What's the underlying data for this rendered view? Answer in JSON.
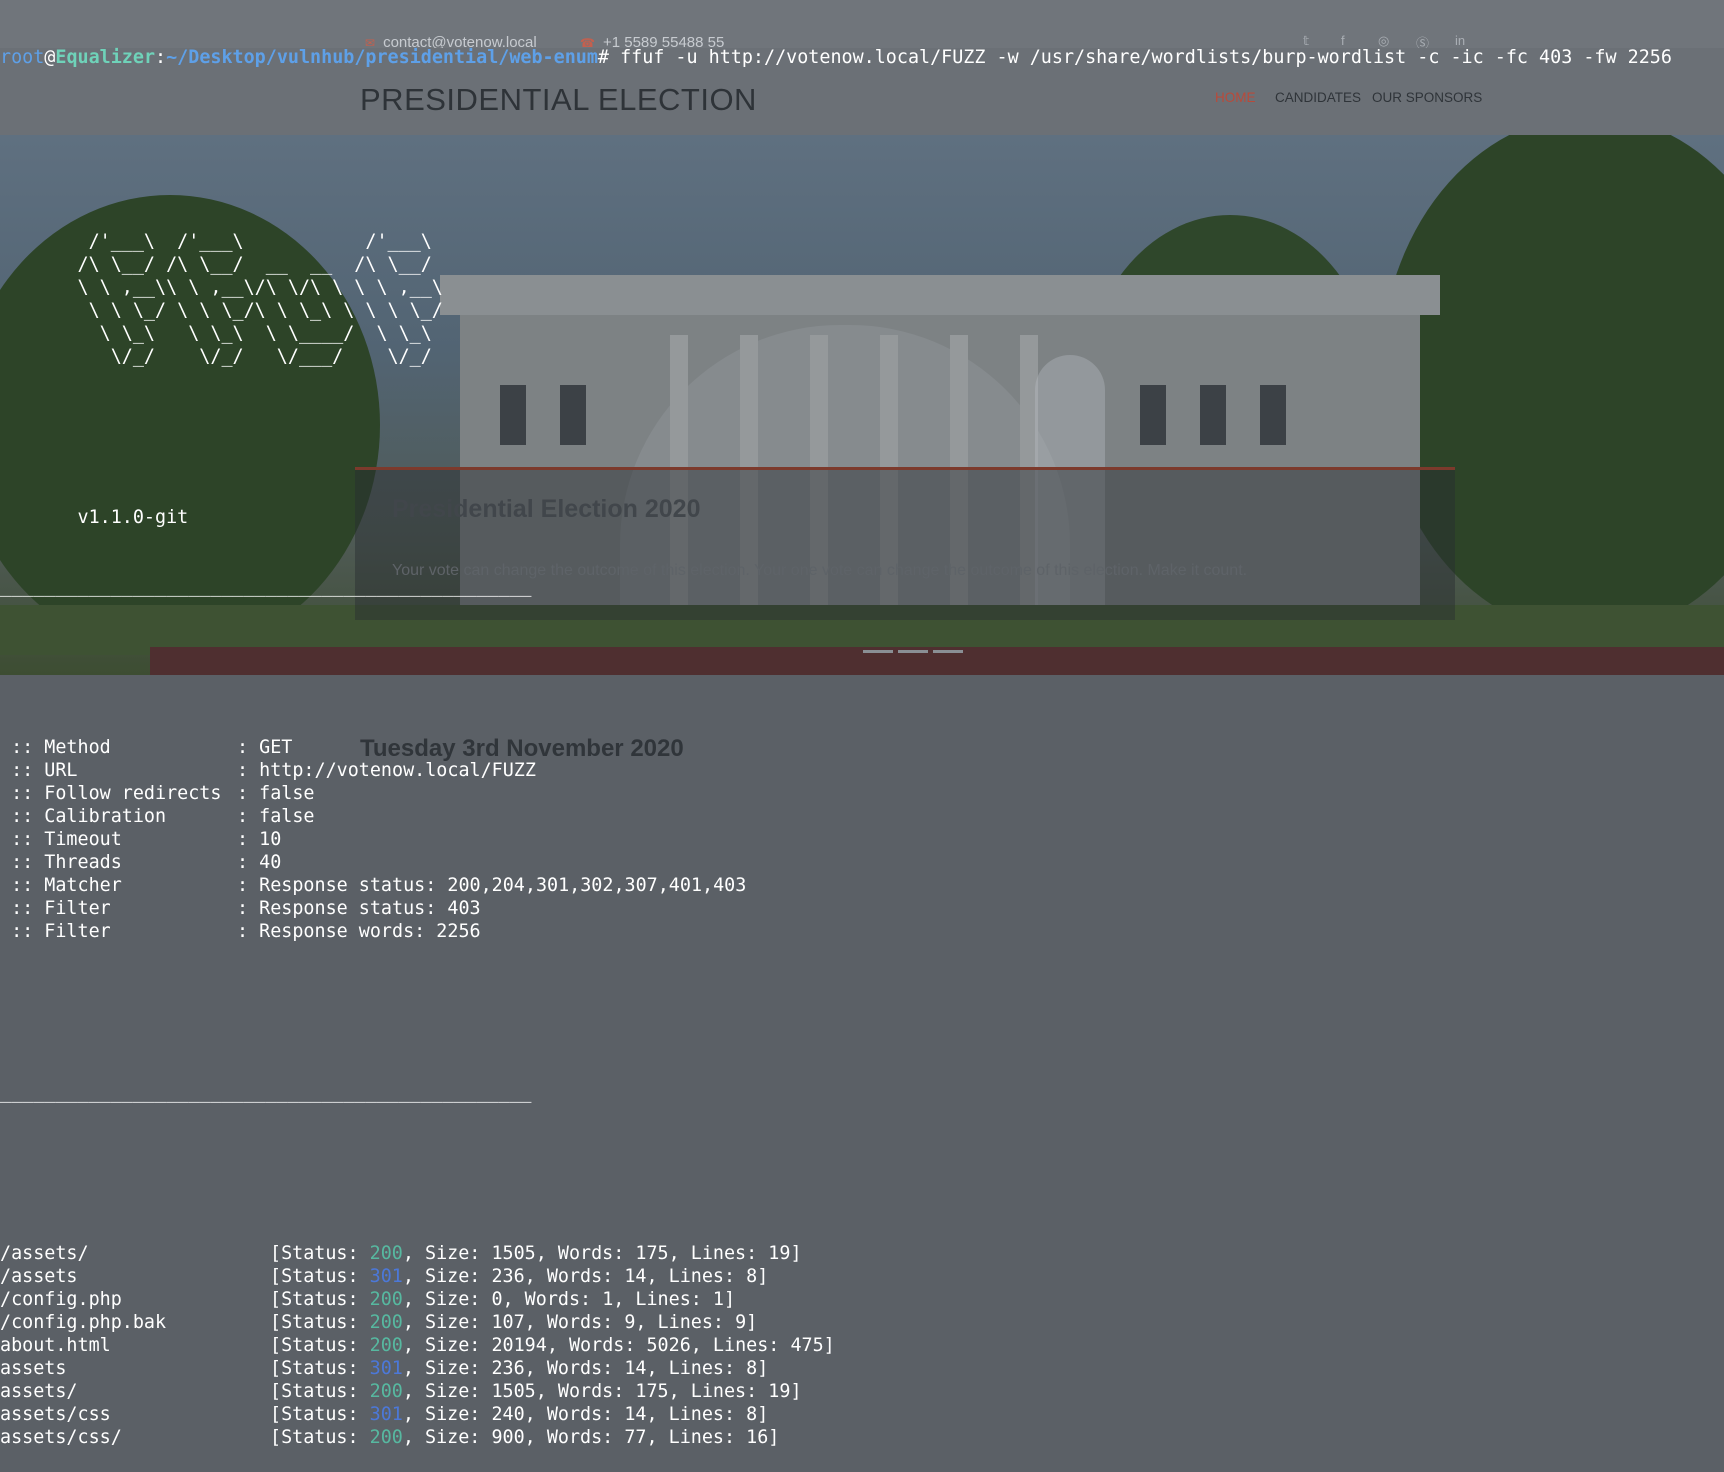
{
  "website": {
    "contact_email": "contact@votenow.local",
    "contact_phone": "+1 5589 55488 55",
    "social_icons": [
      "twitter-icon",
      "facebook-icon",
      "instagram-icon",
      "skype-icon",
      "linkedin-icon"
    ],
    "logo": "PRESIDENTIAL ELECTION",
    "nav": [
      {
        "label": "HOME",
        "active": true
      },
      {
        "label": "CANDIDATES",
        "active": false
      },
      {
        "label": "OUR SPONSORS",
        "active": false
      }
    ],
    "hero_title": "Presidential Election 2020",
    "hero_text": "Your vote can change the outcome of this election. Your one vote can change the outcome of this election. Make it count.",
    "subheading": "Tuesday 3rd November 2020",
    "accent_color": "#b94a3a"
  },
  "terminal": {
    "prompt": {
      "user": "root",
      "at": "@",
      "host": "Equalizer",
      "colon": ":",
      "path": "~/Desktop/vulnhub/presidential/web-enum",
      "hash": "#",
      "command": " ffuf -u http://votenow.local/FUZZ -w /usr/share/wordlists/burp-wordlist -c -ic -fc 403 -fw 2256"
    },
    "banner": [
      "        /'___\\  /'___\\           /'___\\",
      "       /\\ \\__/ /\\ \\__/  __  __  /\\ \\__/",
      "       \\ \\ ,__\\\\ \\ ,__\\/\\ \\/\\ \\ \\ \\ ,__\\",
      "        \\ \\ \\_/ \\ \\ \\_/\\ \\ \\_\\ \\ \\ \\ \\_/",
      "         \\ \\_\\   \\ \\_\\  \\ \\____/  \\ \\_\\",
      "          \\/_/    \\/_/   \\/___/    \\/_/"
    ],
    "version": "       v1.1.0-git",
    "separator": "________________________________________________",
    "config": [
      {
        "key": " :: Method",
        "value": ": GET"
      },
      {
        "key": " :: URL",
        "value": ": http://votenow.local/FUZZ"
      },
      {
        "key": " :: Follow redirects",
        "value": ": false"
      },
      {
        "key": " :: Calibration",
        "value": ": false"
      },
      {
        "key": " :: Timeout",
        "value": ": 10"
      },
      {
        "key": " :: Threads",
        "value": ": 40"
      },
      {
        "key": " :: Matcher",
        "value": ": Response status: 200,204,301,302,307,401,403"
      },
      {
        "key": " :: Filter",
        "value": ": Response status: 403"
      },
      {
        "key": " :: Filter",
        "value": ": Response words: 2256"
      }
    ],
    "results": [
      {
        "path": "/assets/",
        "status": "200",
        "size": "1505",
        "words": "175",
        "lines": "19"
      },
      {
        "path": "/assets",
        "status": "301",
        "size": "236",
        "words": "14",
        "lines": "8"
      },
      {
        "path": "/config.php",
        "status": "200",
        "size": "0",
        "words": "1",
        "lines": "1"
      },
      {
        "path": "/config.php.bak",
        "status": "200",
        "size": "107",
        "words": "9",
        "lines": "9"
      },
      {
        "path": "about.html",
        "status": "200",
        "size": "20194",
        "words": "5026",
        "lines": "475"
      },
      {
        "path": "assets",
        "status": "301",
        "size": "236",
        "words": "14",
        "lines": "8"
      },
      {
        "path": "assets/",
        "status": "200",
        "size": "1505",
        "words": "175",
        "lines": "19"
      },
      {
        "path": "assets/css",
        "status": "301",
        "size": "240",
        "words": "14",
        "lines": "8"
      },
      {
        "path": "assets/css/",
        "status": "200",
        "size": "900",
        "words": "77",
        "lines": "16"
      }
    ],
    "status_colors": {
      "200": "#57b8a0",
      "301": "#4c78d8"
    }
  }
}
